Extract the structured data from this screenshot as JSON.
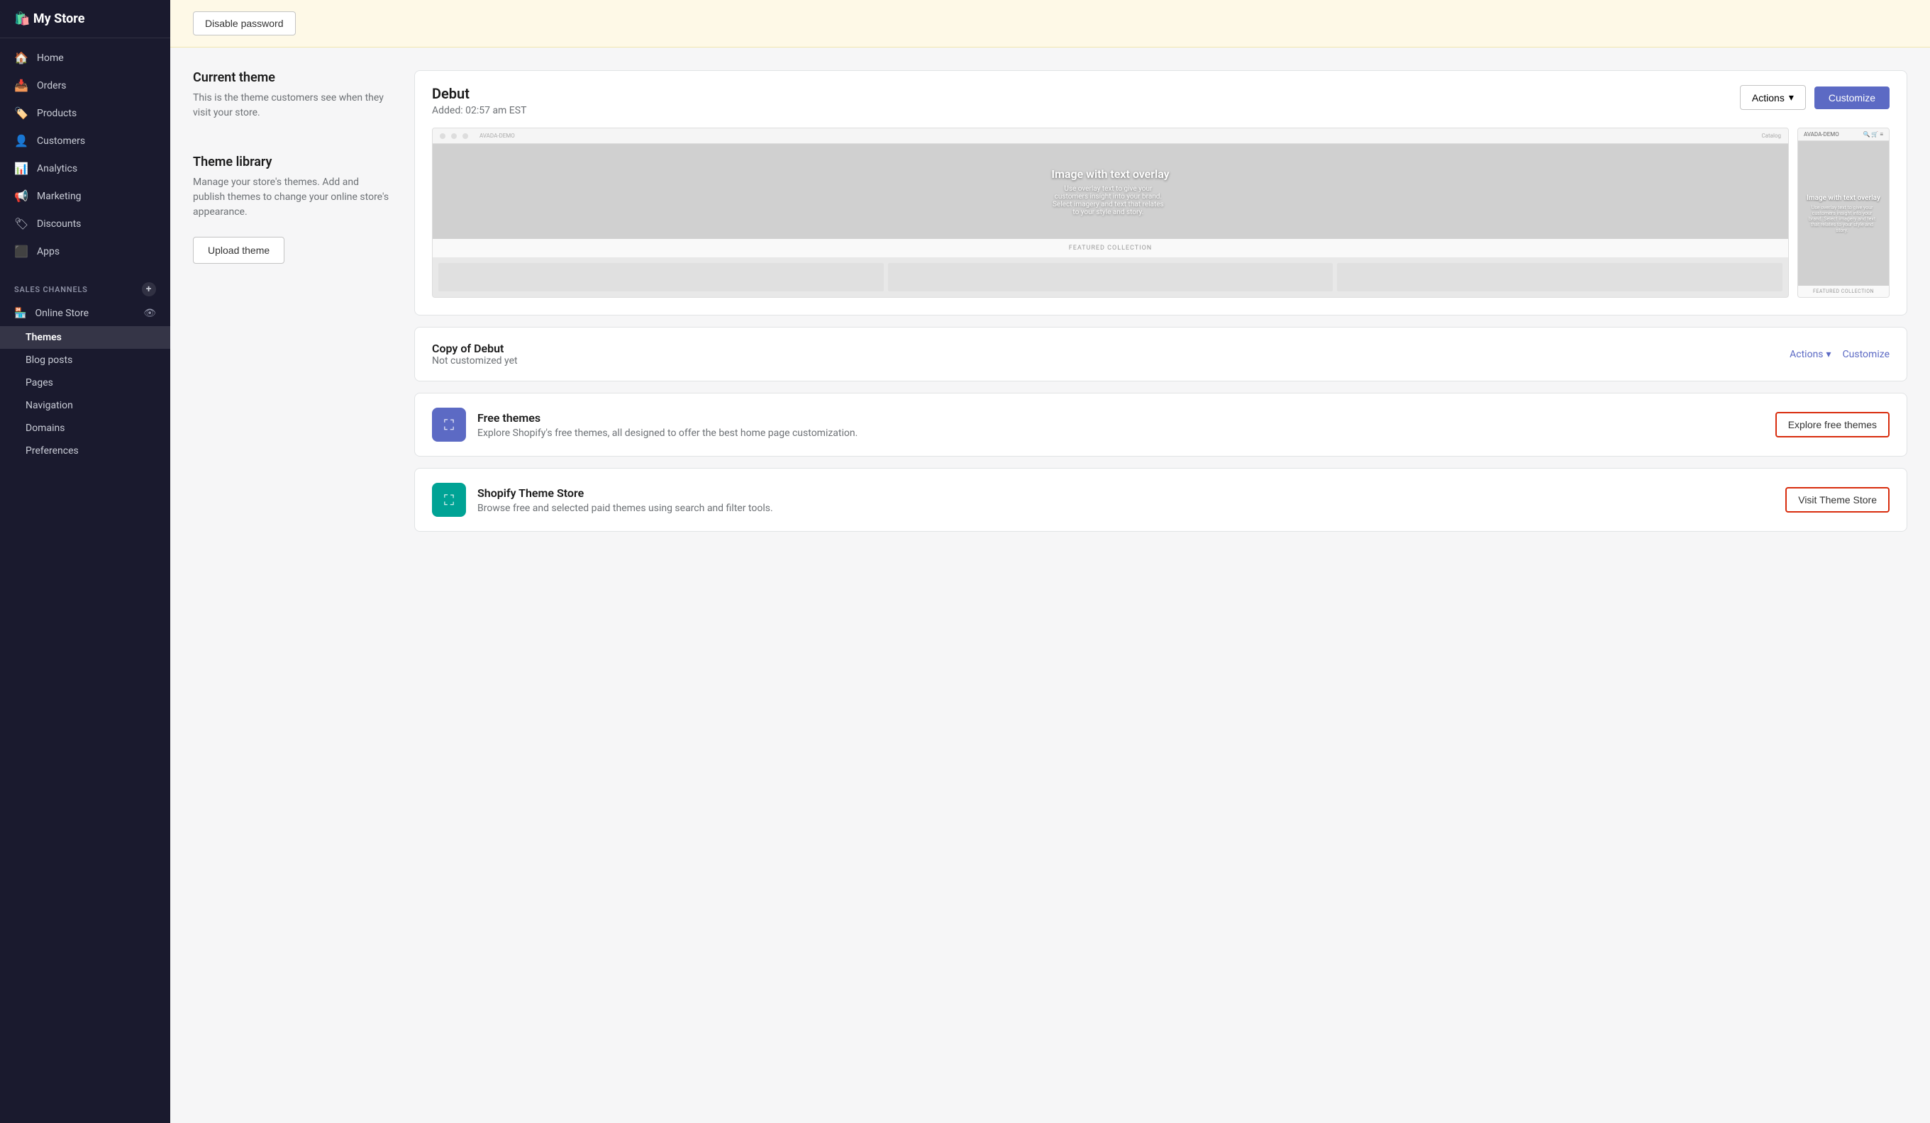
{
  "sidebar": {
    "logo": "🛍️ My Store",
    "nav_items": [
      {
        "id": "home",
        "label": "Home",
        "icon": "🏠"
      },
      {
        "id": "orders",
        "label": "Orders",
        "icon": "📥"
      },
      {
        "id": "products",
        "label": "Products",
        "icon": "🏷️"
      },
      {
        "id": "customers",
        "label": "Customers",
        "icon": "👤"
      },
      {
        "id": "analytics",
        "label": "Analytics",
        "icon": "📊"
      },
      {
        "id": "marketing",
        "label": "Marketing",
        "icon": "📢"
      },
      {
        "id": "discounts",
        "label": "Discounts",
        "icon": "🏷"
      },
      {
        "id": "apps",
        "label": "Apps",
        "icon": "⬛"
      }
    ],
    "sales_channels_label": "SALES CHANNELS",
    "online_store_label": "Online Store",
    "sub_items": [
      {
        "id": "themes",
        "label": "Themes",
        "active": true
      },
      {
        "id": "blog-posts",
        "label": "Blog posts"
      },
      {
        "id": "pages",
        "label": "Pages"
      },
      {
        "id": "navigation",
        "label": "Navigation"
      },
      {
        "id": "domains",
        "label": "Domains"
      },
      {
        "id": "preferences",
        "label": "Preferences"
      }
    ]
  },
  "banner": {
    "button_label": "Disable password"
  },
  "current_theme": {
    "section_title": "Current theme",
    "section_desc": "This is the theme customers see when they visit your store.",
    "theme_name": "Debut",
    "theme_date": "Added: 02:57 am EST",
    "actions_label": "Actions",
    "customize_label": "Customize",
    "preview": {
      "overlay_title": "Image with text overlay",
      "overlay_desc": "Use overlay text to give your customers insight into your brand. Select imagery and text that relates to your style and story.",
      "featured_label": "FEATURED COLLECTION",
      "mobile_overlay_title": "Image with text overlay",
      "mobile_overlay_desc": "Use overlay text to give your customers insight into your brand. Select imagery and text that relates to your style and story.",
      "mobile_featured_label": "FEATURED COLLECTION"
    }
  },
  "theme_library": {
    "section_title": "Theme library",
    "section_desc": "Manage your store's themes. Add and publish themes to change your online store's appearance.",
    "upload_label": "Upload theme",
    "copy_name": "Copy of Debut",
    "copy_status": "Not customized yet",
    "copy_actions_label": "Actions",
    "copy_customize_label": "Customize",
    "free_themes": {
      "icon": "🖼",
      "title": "Free themes",
      "desc": "Explore Shopify's free themes, all designed to offer the best home page customization.",
      "button_label": "Explore free themes"
    },
    "theme_store": {
      "icon": "🖼",
      "title": "Shopify Theme Store",
      "desc": "Browse free and selected paid themes using search and filter tools.",
      "button_label": "Visit Theme Store"
    }
  }
}
